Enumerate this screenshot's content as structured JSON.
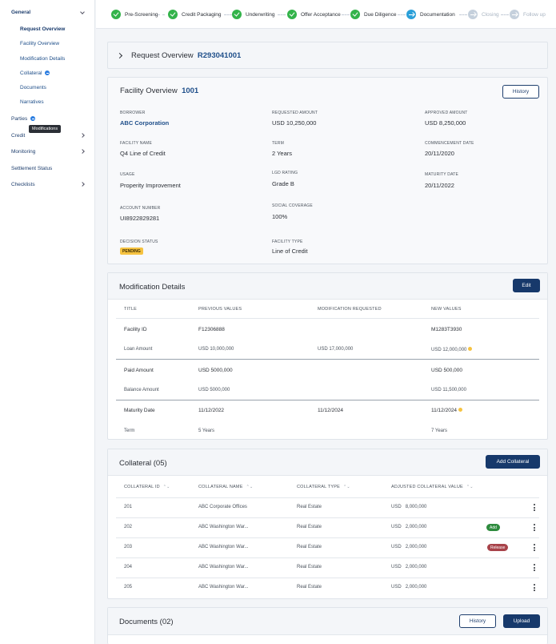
{
  "sidebar": {
    "sections": [
      {
        "label": "General"
      },
      {
        "label": "Parties"
      },
      {
        "label": "Credit"
      },
      {
        "label": "Monitoring"
      },
      {
        "label": "Settlement Status"
      },
      {
        "label": "Checklists"
      }
    ],
    "general_items": [
      {
        "label": "Request Overview"
      },
      {
        "label": "Facility Overview"
      },
      {
        "label": "Modification Details"
      },
      {
        "label": "Collateral"
      },
      {
        "label": "Documents"
      },
      {
        "label": "Narratives"
      }
    ],
    "tooltip": "Modifications"
  },
  "stepper": {
    "steps": [
      {
        "label": "Pre-Screening",
        "state": "done"
      },
      {
        "label": "Credit Packaging",
        "state": "done"
      },
      {
        "label": "Underwriting",
        "state": "done"
      },
      {
        "label": "Offer Acceptance",
        "state": "done"
      },
      {
        "label": "Due Diligence",
        "state": "done"
      },
      {
        "label": "Documentation",
        "state": "current"
      },
      {
        "label": "Closing",
        "state": "future"
      },
      {
        "label": "Follow up",
        "state": "future"
      }
    ]
  },
  "request_overview": {
    "title": "Request Overview",
    "ref": "R293041001"
  },
  "facility": {
    "title": "Facility Overview",
    "ref": "1001",
    "history_label": "History",
    "fields": {
      "borrower": {
        "label": "Borrower",
        "value": "ABC Corporation"
      },
      "requested_amount": {
        "label": "Requested Amount",
        "value": "USD 10,250,000"
      },
      "approved_amount": {
        "label": "Approved Amount",
        "value": "USD 8,250,000"
      },
      "facility_name": {
        "label": "Facility Name",
        "value": "Q4 Line of Credit"
      },
      "term": {
        "label": "Term",
        "value": "2 Years"
      },
      "commencement_date": {
        "label": "Commencement Date",
        "value": "20/11/2020"
      },
      "usage": {
        "label": "Usage",
        "value": "Properity Improvement"
      },
      "lgd_rating": {
        "label": "LGD Rating",
        "value": "Grade B"
      },
      "maturity_date": {
        "label": "Maturity Date",
        "value": "20/11/2022"
      },
      "account_number": {
        "label": "Account Number",
        "value": "UI8922829281"
      },
      "social_coverage": {
        "label": "Social Coverage",
        "value": "100%"
      },
      "decision_status": {
        "label": "Decision Status",
        "value": "PENDING"
      },
      "facility_type": {
        "label": "Facility Type",
        "value": "Line of Credit"
      }
    }
  },
  "modification": {
    "title": "Modification Details",
    "edit_label": "Edit",
    "columns": [
      "Title",
      "Previous Values",
      "Modification Requested",
      "New Values"
    ],
    "rows": [
      {
        "title": "Facility ID",
        "previous": "F12306888",
        "requested": "",
        "new": "M1283T3930",
        "flag": false,
        "primary": true
      },
      {
        "title": "Loan Amount",
        "previous": "USD 10,000,000",
        "requested": "USD 17,000,000",
        "new": "USD 12,000,000",
        "flag": true,
        "primary": false
      },
      {
        "title": "Paid Amount",
        "previous": "USD 5000,000",
        "requested": "",
        "new": "USD 500,000",
        "flag": false,
        "primary": true
      },
      {
        "title": "Balance Amount",
        "previous": "USD 5000,000",
        "requested": "",
        "new": "USD 11,500,000",
        "flag": false,
        "primary": false
      },
      {
        "title": "Maturity Date",
        "previous": "11/12/2022",
        "requested": "11/12/2024",
        "new": "11/12/2024",
        "flag": true,
        "primary": true
      },
      {
        "title": "Term",
        "previous": "5 Years",
        "requested": "",
        "new": "7 Years",
        "flag": false,
        "primary": false
      }
    ]
  },
  "collateral": {
    "title": "Collateral (05)",
    "add_label": "Add Collateral",
    "columns": [
      "Collateral ID",
      "Collateral Name",
      "Collateral Type",
      "Adjusted Collateral Value"
    ],
    "rows": [
      {
        "id": "201",
        "name": "ABC Corporate Offices",
        "type": "Real Estate",
        "currency": "USD",
        "value": "8,000,000",
        "tag": ""
      },
      {
        "id": "202",
        "name": "ABC Washington War...",
        "type": "Real Estate",
        "currency": "USD",
        "value": "2,000,000",
        "tag": "Add"
      },
      {
        "id": "203",
        "name": "ABC Washington War...",
        "type": "Real Estate",
        "currency": "USD",
        "value": "2,000,000",
        "tag": "Release"
      },
      {
        "id": "204",
        "name": "ABC Washington War...",
        "type": "Real Estate",
        "currency": "USD",
        "value": "2,000,000",
        "tag": ""
      },
      {
        "id": "205",
        "name": "ABC Washington War...",
        "type": "Real Estate",
        "currency": "USD",
        "value": "2,000,000",
        "tag": ""
      }
    ]
  },
  "documents": {
    "title": "Documents (02)",
    "history_label": "History",
    "upload_label": "Upload"
  }
}
